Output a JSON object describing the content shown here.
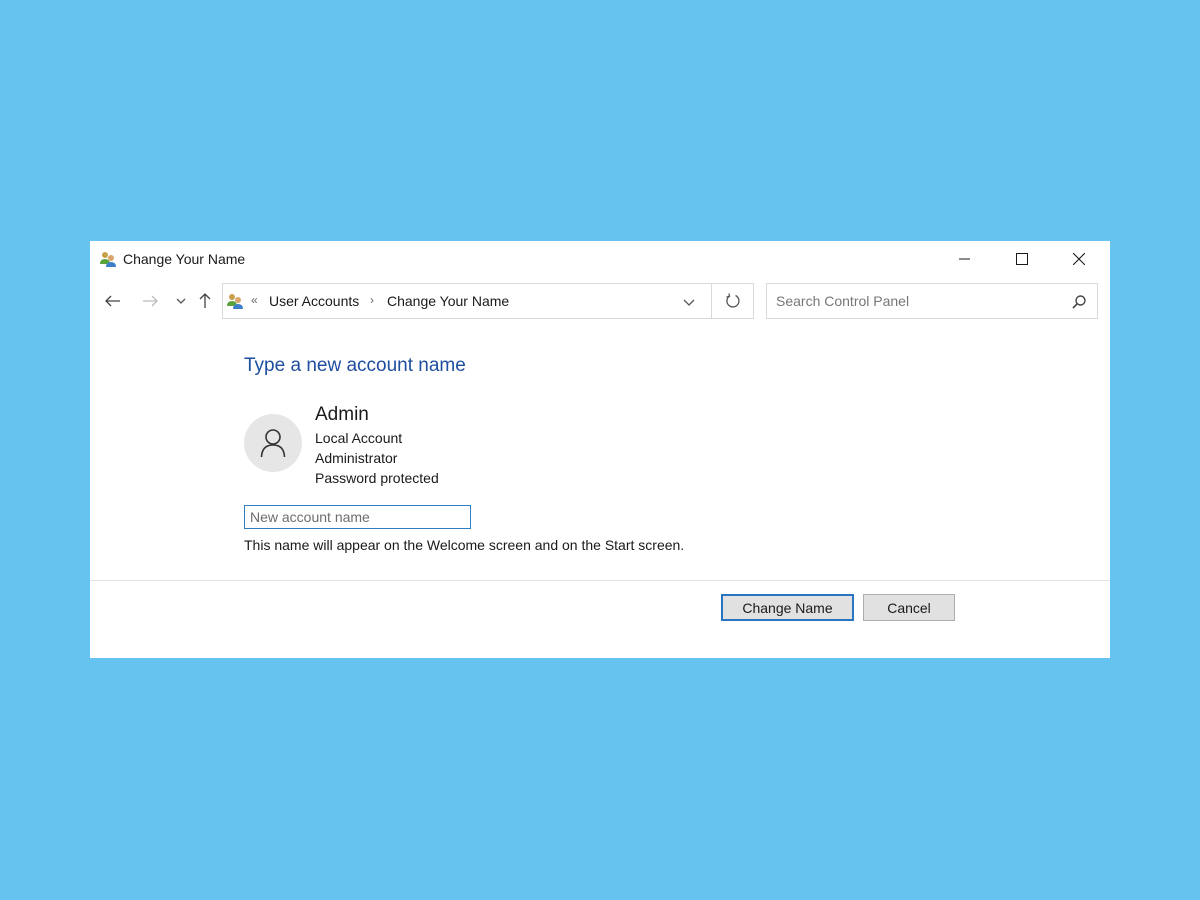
{
  "window": {
    "title": "Change Your Name",
    "icon": "user-accounts-icon",
    "controls": {
      "minimize": "minimize-icon",
      "maximize": "maximize-icon",
      "close": "close-icon"
    }
  },
  "navigation": {
    "back": "back-arrow-icon",
    "forward": "forward-arrow-icon",
    "recent": "chevron-down-icon",
    "up": "up-arrow-icon"
  },
  "address_bar": {
    "overflow_glyph": "«",
    "separator_glyph": "›",
    "breadcrumbs": [
      {
        "label": "User Accounts"
      },
      {
        "label": "Change Your Name"
      }
    ]
  },
  "search": {
    "placeholder": "Search Control Panel",
    "value": ""
  },
  "content": {
    "heading": "Type a new account name",
    "user": {
      "name": "Admin",
      "details": [
        "Local Account",
        "Administrator",
        "Password protected"
      ]
    },
    "name_input": {
      "placeholder": "New account name",
      "value": ""
    },
    "hint": "This name will appear on the Welcome screen and on the Start screen."
  },
  "buttons": {
    "change_name": "Change Name",
    "cancel": "Cancel"
  },
  "colors": {
    "desktop_background": "#66c3ef",
    "heading": "#1e4e9f",
    "focus_border": "#2a74c2"
  }
}
